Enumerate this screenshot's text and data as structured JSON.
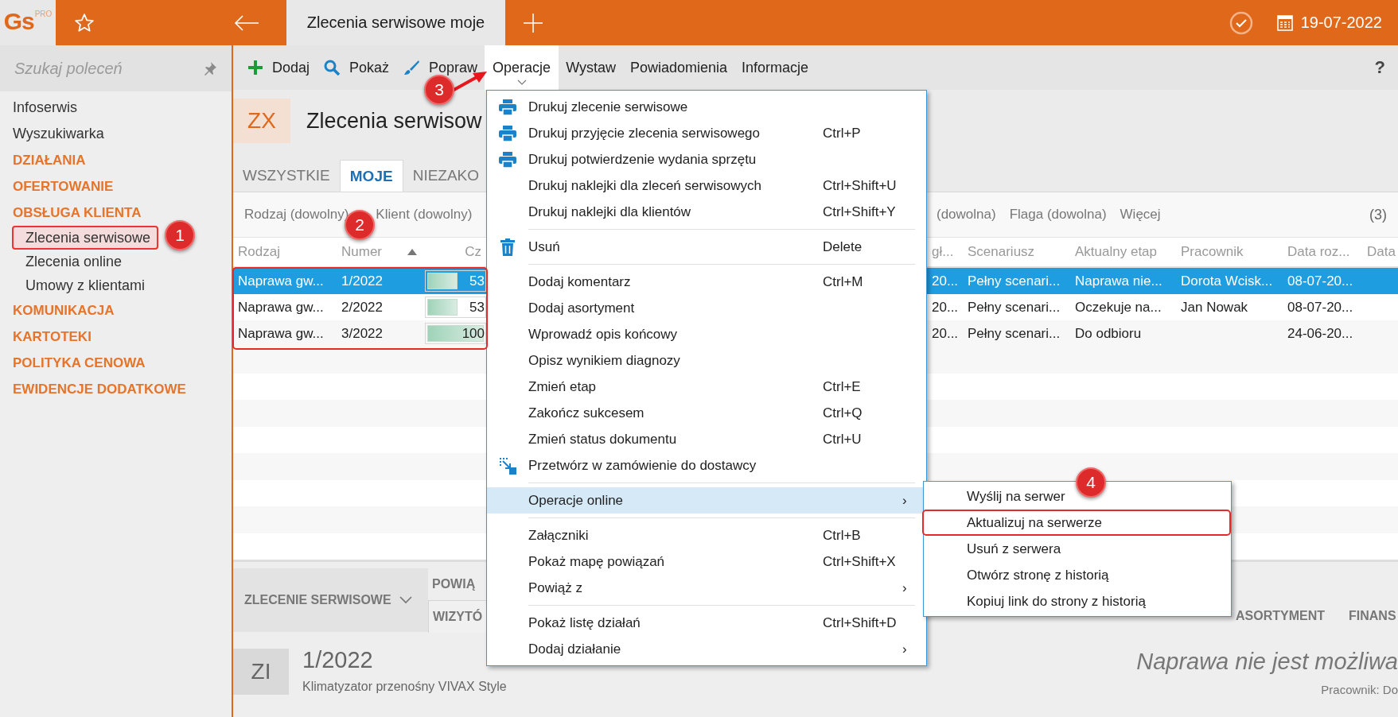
{
  "topbar": {
    "logo": "Gs",
    "logo_badge": "PRO",
    "tabs": [
      {
        "label": "Zlecenia serwisowe moje",
        "selected": true
      }
    ],
    "date": "19-07-2022"
  },
  "sidebar": {
    "search": {
      "placeholder": "Szukaj poleceń"
    },
    "items": [
      {
        "label": "Infoserwis",
        "kind": "link",
        "selected": false
      },
      {
        "label": "Wyszukiwarka",
        "kind": "link",
        "selected": false
      },
      {
        "label": "DZIAŁANIA",
        "kind": "section",
        "selected": false
      },
      {
        "label": "OFERTOWANIE",
        "kind": "section",
        "selected": false
      },
      {
        "label": "OBSŁUGA KLIENTA",
        "kind": "section",
        "selected": false,
        "children": [
          {
            "label": "Zlecenia serwisowe",
            "selected": true
          },
          {
            "label": "Zlecenia online",
            "selected": false
          },
          {
            "label": "Umowy z klientami",
            "selected": false
          }
        ]
      },
      {
        "label": "KOMUNIKACJA",
        "kind": "section",
        "selected": false
      },
      {
        "label": "KARTOTEKI",
        "kind": "section",
        "selected": false
      },
      {
        "label": "POLITYKA CENOWA",
        "kind": "section",
        "selected": false
      },
      {
        "label": "EWIDENCJE DODATKOWE",
        "kind": "section",
        "selected": false
      }
    ]
  },
  "toolbar": {
    "items": [
      {
        "label": "Dodaj",
        "kind": "add",
        "selected": false
      },
      {
        "label": "Pokaż",
        "kind": "view",
        "selected": false
      },
      {
        "label": "Popraw",
        "kind": "edit",
        "selected": false
      },
      {
        "label": "Operacje",
        "kind": "plain",
        "selected": true
      },
      {
        "label": "Wystaw",
        "kind": "plain",
        "selected": false
      },
      {
        "label": "Powiadomienia",
        "kind": "plain",
        "selected": false
      },
      {
        "label": "Informacje",
        "kind": "plain",
        "selected": false
      }
    ],
    "help": "?"
  },
  "header": {
    "code": "ZX",
    "title": "Zlecenia serwisow"
  },
  "tabs": [
    {
      "label": "WSZYSTKIE",
      "selected": false
    },
    {
      "label": "MOJE",
      "selected": true
    },
    {
      "label": "NIEZAKO",
      "selected": false
    }
  ],
  "filters": {
    "left": [
      "Rodzaj (dowolny)",
      "Klient (dowolny)"
    ],
    "right": [
      "(dowolna)",
      "Flaga (dowolna)",
      "Więcej"
    ],
    "count": "(3)"
  },
  "table": {
    "columns": [
      {
        "label": "Rodzaj"
      },
      {
        "label": "Numer",
        "sorted": true
      },
      {
        "label": "Cz"
      },
      {
        "label": "gł..."
      },
      {
        "label": "Scenariusz"
      },
      {
        "label": "Aktualny etap"
      },
      {
        "label": "Pracownik"
      },
      {
        "label": "Data roz..."
      },
      {
        "label": "Data"
      }
    ],
    "rows": [
      {
        "selected": true,
        "rodzaj": "Naprawa gw...",
        "numer": "1/2022",
        "level": 0.53,
        "reading": "53",
        "right": {
          "gl": "20...",
          "scenariusz": "Pełny scenari...",
          "etap": "Naprawa nie...",
          "pracownik": "Dorota Wcisk...",
          "data": "08-07-20..."
        }
      },
      {
        "selected": false,
        "rodzaj": "Naprawa gw...",
        "numer": "2/2022",
        "level": 0.53,
        "reading": "53",
        "right": {
          "gl": "20...",
          "scenariusz": "Pełny scenari...",
          "etap": "Oczekuje na...",
          "pracownik": "Jan Nowak",
          "data": "08-07-20..."
        }
      },
      {
        "selected": false,
        "rodzaj": "Naprawa gw...",
        "numer": "3/2022",
        "level": 1,
        "reading": "100",
        "right": {
          "gl": "20...",
          "scenariusz": "Pełny scenari...",
          "etap": "Do odbioru",
          "data": "24-06-20..."
        }
      }
    ]
  },
  "detail": {
    "section": "ZLECENIE SERWISOWE",
    "tabs_left": [
      {
        "label": "POWIĄ",
        "selected": false
      },
      {
        "label": "WIZYTÓ",
        "selected": true
      }
    ],
    "tabs_right": [
      {
        "label": "ASORTYMENT",
        "selected": false
      },
      {
        "label": "FINANS",
        "selected": false
      }
    ],
    "code": "ZI",
    "number": "1/2022",
    "device": "Klimatyzator przenośny VIVAX Style",
    "status": "Naprawa nie jest możliwa",
    "employee": "Pracownik: Do"
  },
  "menu": {
    "groups": [
      [
        {
          "label": "Drukuj zlecenie serwisowe",
          "kind": "print",
          "highlighted": false
        },
        {
          "label": "Drukuj przyjęcie zlecenia serwisowego",
          "shortcut": "Ctrl+P",
          "kind": "print",
          "highlighted": false
        },
        {
          "label": "Drukuj potwierdzenie wydania sprzętu",
          "kind": "print",
          "highlighted": false
        },
        {
          "label": "Drukuj naklejki dla zleceń serwisowych",
          "shortcut": "Ctrl+Shift+U",
          "kind": "plain",
          "highlighted": false
        },
        {
          "label": "Drukuj naklejki dla klientów",
          "shortcut": "Ctrl+Shift+Y",
          "kind": "plain",
          "highlighted": false
        }
      ],
      [
        {
          "label": "Usuń",
          "shortcut": "Delete",
          "kind": "delete",
          "highlighted": false
        }
      ],
      [
        {
          "label": "Dodaj komentarz",
          "shortcut": "Ctrl+M",
          "kind": "plain",
          "highlighted": false
        },
        {
          "label": "Dodaj asortyment",
          "kind": "plain",
          "highlighted": false
        },
        {
          "label": "Wprowadź opis końcowy",
          "kind": "plain",
          "highlighted": false
        },
        {
          "label": "Opisz wynikiem diagnozy",
          "kind": "plain",
          "highlighted": false
        },
        {
          "label": "Zmień etap",
          "shortcut": "Ctrl+E",
          "kind": "plain",
          "highlighted": false
        },
        {
          "label": "Zakończ sukcesem",
          "shortcut": "Ctrl+Q",
          "kind": "plain",
          "highlighted": false
        },
        {
          "label": "Zmień status dokumentu",
          "shortcut": "Ctrl+U",
          "kind": "plain",
          "highlighted": false
        },
        {
          "label": "Przetwórz w zamówienie do dostawcy",
          "kind": "convert",
          "highlighted": false
        }
      ],
      [
        {
          "label": "Operacje online",
          "arrow": "›",
          "kind": "plain",
          "highlighted": true
        }
      ],
      [
        {
          "label": "Załączniki",
          "shortcut": "Ctrl+B",
          "kind": "plain",
          "highlighted": false
        },
        {
          "label": "Pokaż mapę powiązań",
          "shortcut": "Ctrl+Shift+X",
          "kind": "plain",
          "highlighted": false
        },
        {
          "label": "Powiąż z",
          "arrow": "›",
          "kind": "plain",
          "highlighted": false
        }
      ],
      [
        {
          "label": "Pokaż listę działań",
          "shortcut": "Ctrl+Shift+D",
          "kind": "plain",
          "highlighted": false
        },
        {
          "label": "Dodaj działanie",
          "arrow": "›",
          "kind": "plain",
          "highlighted": false
        }
      ]
    ],
    "submenu": [
      {
        "label": "Wyślij na serwer",
        "outlined": false
      },
      {
        "label": "Aktualizuj na serwerze",
        "outlined": true
      },
      {
        "label": "Usuń z serwera",
        "outlined": false
      },
      {
        "label": "Otwórz stronę z historią",
        "outlined": false
      },
      {
        "label": "Kopiuj link do strony z historią",
        "outlined": false
      }
    ]
  },
  "callouts": [
    "1",
    "2",
    "3",
    "4"
  ]
}
